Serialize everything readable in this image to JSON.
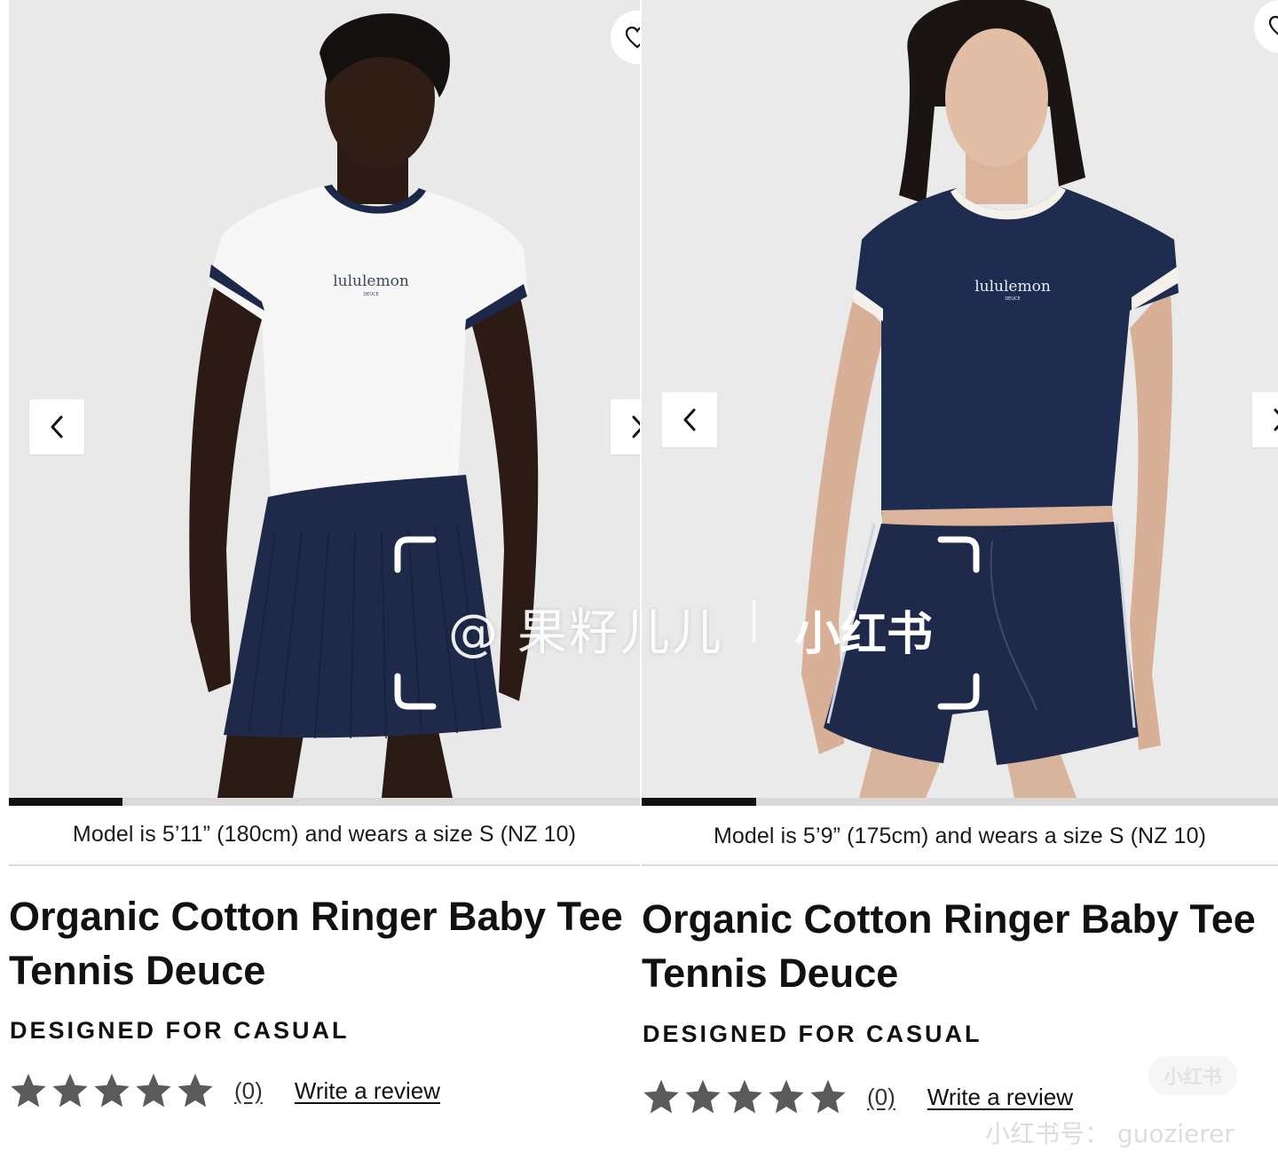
{
  "panels": [
    {
      "id": "left",
      "gallery": {
        "prev_icon": "chevron-left-icon",
        "next_icon": "chevron-right-icon",
        "wishlist_icon": "heart-icon",
        "progress_fraction": 0.18,
        "shirt_color": "#f7f7f7",
        "trim_color": "#1c2847",
        "bottom_color": "#1f2a4a",
        "shirt_logo": "lululemon",
        "shirt_logo_sub": "DEUCE"
      },
      "caption": "Model is 5’11” (180cm) and wears a size S (NZ 10)",
      "title": "Organic Cotton Ringer Baby Tee Tennis Deuce",
      "title_line1": "Organic Cotton Ringer Baby Tee",
      "title_line2": "Tennis Deuce",
      "subtitle": "DESIGNED FOR CASUAL",
      "rating": {
        "stars": 5,
        "count_label": "(0)",
        "write_review": "Write a review"
      }
    },
    {
      "id": "right",
      "gallery": {
        "prev_icon": "chevron-left-icon",
        "next_icon": "chevron-right-icon",
        "wishlist_icon": "heart-icon",
        "progress_fraction": 0.18,
        "shirt_color": "#1e2d4f",
        "trim_color": "#f3f1ea",
        "bottom_color": "#1f2a4a",
        "shirt_logo": "lululemon",
        "shirt_logo_sub": "DEUCE"
      },
      "caption": "Model is 5’9” (175cm) and wears a size S (NZ 10)",
      "title": "Organic Cotton Ringer Baby Tee Tennis Deuce",
      "title_line1": "Organic Cotton Ringer Baby Tee",
      "title_line2": "Tennis Deuce",
      "subtitle": "DESIGNED FOR CASUAL",
      "rating": {
        "stars": 5,
        "count_label": "(0)",
        "write_review": "Write a review"
      }
    }
  ],
  "watermark": {
    "handle": "@ 果籽儿儿",
    "brand": "小红书",
    "badge": "小红书",
    "user_id": "小红书号： guozierer"
  },
  "colors": {
    "star": "#5a5a5a",
    "progress_track": "#d9d9d9",
    "progress_fill": "#111111",
    "background": "#e9e9ea"
  }
}
